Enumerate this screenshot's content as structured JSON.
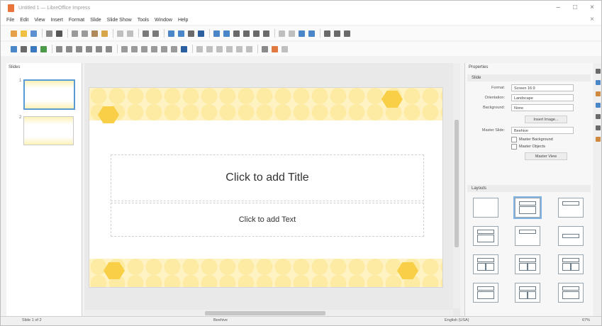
{
  "window": {
    "title": "Untitled 1 — LibreOffice Impress"
  },
  "menu": [
    "File",
    "Edit",
    "View",
    "Insert",
    "Format",
    "Slide",
    "Slide Show",
    "Tools",
    "Window",
    "Help"
  ],
  "slides_pane": {
    "label": "Slides",
    "slide_numbers": [
      "1",
      "2"
    ]
  },
  "slide": {
    "title_placeholder": "Click to add Title",
    "text_placeholder": "Click to add Text"
  },
  "sidebar": {
    "header": "Properties",
    "section_slide": "Slide",
    "format_label": "Format:",
    "format_value": "Screen 16:9",
    "orientation_label": "Orientation:",
    "orientation_value": "Landscape",
    "background_label": "Background:",
    "background_value": "None",
    "insert_image": "Insert Image...",
    "master_slide_label": "Master Slide:",
    "master_slide_value": "Beehive",
    "master_background": "Master Background",
    "master_objects": "Master Objects",
    "master_view": "Master View",
    "section_layouts": "Layouts"
  },
  "statusbar": {
    "slide": "Slide 1 of 2",
    "master": "Beehive",
    "language": "English (USA)",
    "zoom": "67%"
  },
  "colors": {
    "accent": "#5b9bd5",
    "hex_gold": "#f8cf46",
    "hex_light": "#fdeba4"
  }
}
